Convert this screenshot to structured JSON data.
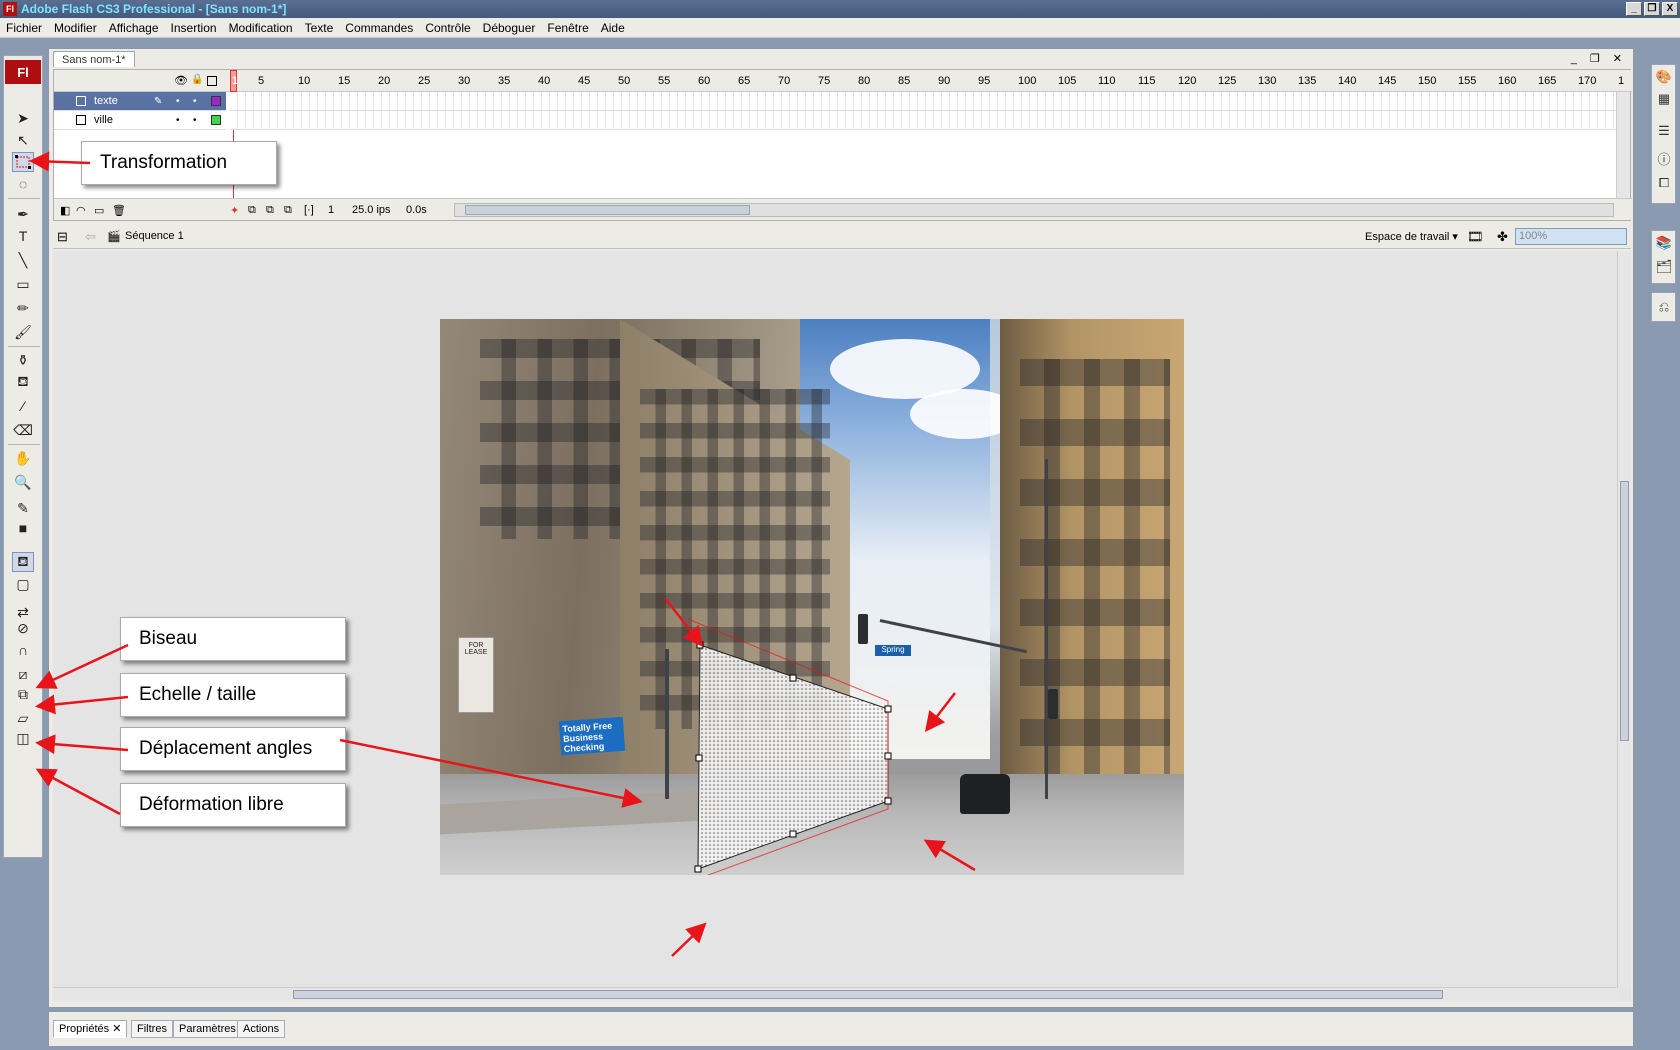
{
  "window": {
    "title": "Adobe Flash CS3 Professional - [Sans nom-1*]",
    "app_icon": "Fl",
    "buttons": [
      "_",
      "❐",
      "X"
    ]
  },
  "menu": [
    "Fichier",
    "Modifier",
    "Affichage",
    "Insertion",
    "Modification",
    "Texte",
    "Commandes",
    "Contrôle",
    "Déboguer",
    "Fenêtre",
    "Aide"
  ],
  "toolbox": {
    "logo": "Fl"
  },
  "document": {
    "tab": "Sans nom-1*",
    "controls": "_ ❐ ✕"
  },
  "timeline": {
    "current_frame_marker": "1",
    "ticks": [
      "5",
      "10",
      "15",
      "20",
      "25",
      "30",
      "35",
      "40",
      "45",
      "50",
      "55",
      "60",
      "65",
      "70",
      "75",
      "80",
      "85",
      "90",
      "95",
      "100",
      "105",
      "110",
      "115",
      "120",
      "125",
      "130",
      "135",
      "140",
      "145",
      "150",
      "155",
      "160",
      "165",
      "170",
      "1"
    ],
    "layers": [
      {
        "name": "texte",
        "color": "#9b27c9",
        "selected": true
      },
      {
        "name": "ville",
        "color": "#3fd54a",
        "selected": false
      }
    ],
    "footer": {
      "frame": "1",
      "fps": "25.0 ips",
      "time": "0.0s"
    }
  },
  "editbar": {
    "scene": "Séquence 1",
    "workspace": "Espace de travail ▾",
    "zoom": "100%"
  },
  "stage": {
    "signs": {
      "lease": "FOR LEASE",
      "blue_line1": "Totally Free",
      "blue_line2": "Business Checking",
      "street": "Spring"
    }
  },
  "callouts": {
    "transformation": "Transformation",
    "biseau": "Biseau",
    "echelle": "Echelle / taille",
    "deplacement": "Déplacement angles",
    "deformation": "Déformation libre"
  },
  "properties": {
    "tabs": [
      "Propriétés",
      "Filtres",
      "Paramètres",
      "Actions"
    ]
  },
  "colors": {
    "arrow": "#e8141a",
    "title_text": "#7fe3ff"
  }
}
